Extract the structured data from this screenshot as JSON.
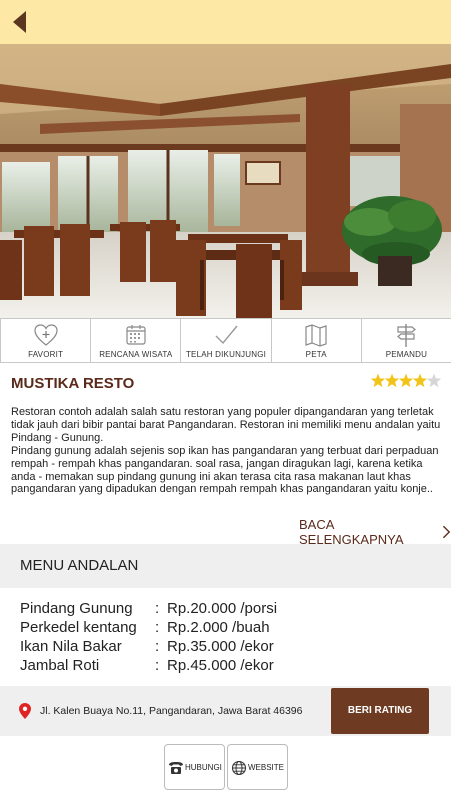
{
  "header": {
    "back_icon": "back-arrow-icon",
    "background": "#fde8a6"
  },
  "hero": {
    "image": "restaurant-interior-photo"
  },
  "actions": [
    {
      "label": "FAVORIT",
      "icon": "heart-plus-icon"
    },
    {
      "label": "RENCANA WISATA",
      "icon": "calendar-icon"
    },
    {
      "label": "TELAH DIKUNJUNGI",
      "icon": "checkmark-icon"
    },
    {
      "label": "PETA",
      "icon": "map-icon"
    },
    {
      "label": "PEMANDU",
      "icon": "signpost-icon"
    }
  ],
  "place": {
    "name": "MUSTIKA RESTO",
    "rating": 4,
    "rating_max": 5,
    "description": [
      "Restoran contoh adalah salah satu restoran yang populer dipangandaran yang terletak tidak jauh dari bibir pantai barat Pangandaran. Restoran ini memiliki menu andalan yaitu Pindang - Gunung.",
      "Pindang gunung adalah sejenis sop ikan has pangandaran yang terbuat dari perpaduan rempah - rempah khas pangandaran. soal rasa, jangan diragukan lagi, karena ketika anda - memakan sup pindang gunung ini akan terasa cita rasa makanan laut khas pangandaran yang dipadukan dengan rempah rempah khas pangandaran yaitu konje.."
    ],
    "read_more": "BACA SELENGKAPNYA"
  },
  "menu": {
    "title": "MENU ANDALAN",
    "items": [
      {
        "name": "Pindang Gunung",
        "colon": ":",
        "price": "Rp.20.000 /porsi"
      },
      {
        "name": "Perkedel kentang",
        "colon": ":",
        "price": "Rp.2.000 /buah"
      },
      {
        "name": "Ikan Nila Bakar",
        "colon": ":",
        "price": "Rp.35.000 /ekor"
      },
      {
        "name": "Jambal Roti",
        "colon": ":",
        "price": "Rp.45.000 /ekor"
      }
    ]
  },
  "address": {
    "text": "Jl. Kalen Buaya No.11, Pangandaran, Jawa Barat 46396",
    "icon": "location-pin-icon",
    "rate_button": "BERI RATING"
  },
  "contact": {
    "call_label": "HUBUNGI",
    "call_icon": "telephone-icon",
    "web_label": "WEBSITE",
    "web_icon": "globe-icon"
  },
  "colors": {
    "brand_brown": "#6e3b22",
    "title_brown": "#5a2a1a",
    "star_gold": "#f2c318",
    "panel_gray": "#efefef"
  }
}
